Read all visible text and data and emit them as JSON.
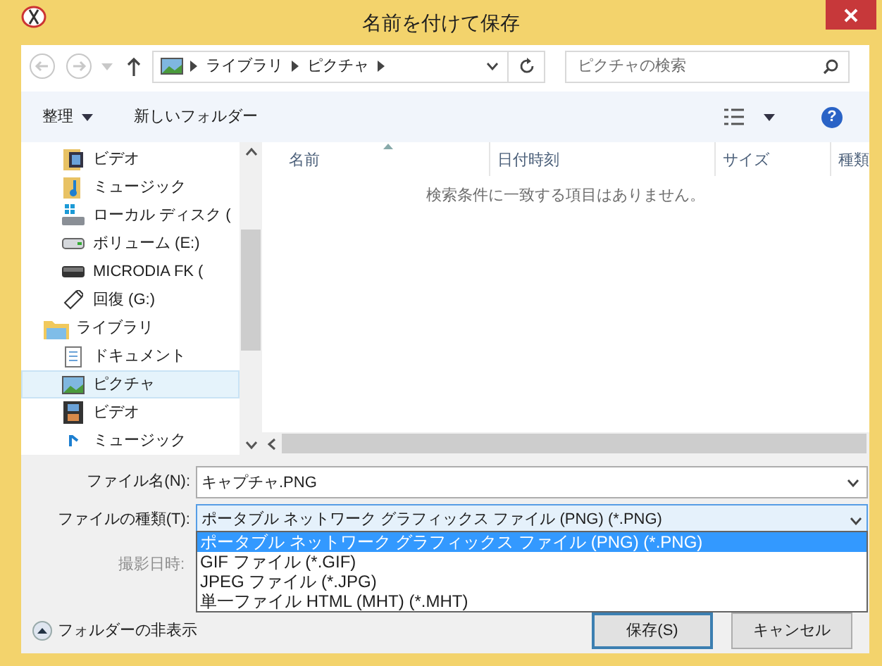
{
  "window": {
    "title": "名前を付けて保存"
  },
  "address": {
    "path": [
      "ライブラリ",
      "ピクチャ"
    ]
  },
  "search": {
    "placeholder": "ピクチャの検索"
  },
  "toolbar": {
    "organize": "整理",
    "new_folder": "新しいフォルダー",
    "help": "?"
  },
  "sidebar": {
    "items_above": [
      {
        "label": "ビデオ",
        "kind": "video-folder",
        "selected": false
      },
      {
        "label": "ミュージック",
        "kind": "music-folder",
        "selected": false
      },
      {
        "label": "ローカル ディスク (",
        "kind": "system-drive",
        "selected": false
      },
      {
        "label": "ボリューム (E:)",
        "kind": "drive",
        "selected": false
      },
      {
        "label": "MICRODIA FK (",
        "kind": "dark-drive",
        "selected": false
      },
      {
        "label": "回復 (G:)",
        "kind": "usb",
        "selected": false
      }
    ],
    "items": [
      {
        "label": "ライブラリ",
        "kind": "library",
        "selected": false,
        "children": [
          {
            "label": "ドキュメント",
            "kind": "document",
            "selected": false
          },
          {
            "label": "ピクチャ",
            "kind": "picture",
            "selected": true
          },
          {
            "label": "ビデオ",
            "kind": "film",
            "selected": false
          },
          {
            "label": "ミュージック",
            "kind": "music",
            "selected": false
          }
        ]
      }
    ]
  },
  "columns": [
    {
      "label": "名前",
      "sorted": true
    },
    {
      "label": "日付時刻",
      "sorted": false
    },
    {
      "label": "サイズ",
      "sorted": false
    },
    {
      "label": "種類",
      "sorted": false
    }
  ],
  "empty_message": "検索条件に一致する項目はありません。",
  "file_name": {
    "label": "ファイル名(N):",
    "value": "キャプチャ.PNG"
  },
  "file_type": {
    "label": "ファイルの種類(T):",
    "value": "ポータブル ネットワーク グラフィックス ファイル (PNG) (*.PNG)",
    "expanded": true,
    "options": [
      {
        "label": "ポータブル ネットワーク グラフィックス ファイル (PNG) (*.PNG)",
        "selected": true
      },
      {
        "label": "GIF ファイル (*.GIF)",
        "selected": false
      },
      {
        "label": "JPEG ファイル (*.JPG)",
        "selected": false
      },
      {
        "label": "単一ファイル HTML (MHT) (*.MHT)",
        "selected": false
      }
    ]
  },
  "date_taken": {
    "label": "撮影日時:",
    "disabled": true
  },
  "hide_folders": "フォルダーの非表示",
  "buttons": [
    {
      "label": "保存(S)",
      "default": true
    },
    {
      "label": "キャンセル",
      "default": false
    }
  ]
}
